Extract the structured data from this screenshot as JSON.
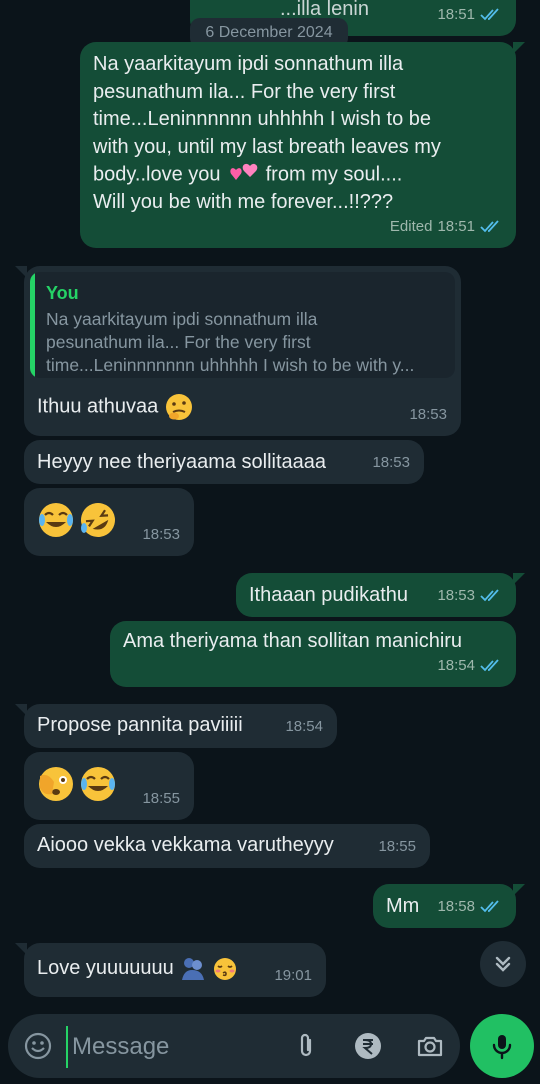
{
  "date_separator": "6 December 2024",
  "messages": [
    {
      "text": "...illa lenin",
      "time": "18:51"
    },
    {
      "text": "Na yaarkitayum ipdi sonnathum illa\npesunathum ila... For the very first\ntime...Leninnnnnn uhhhhh I wish to be\nwith you, until my last breath leaves my\nbody..love you",
      "text_after": "from my soul....\nWill you be with me forever...!!???",
      "edited_label": "Edited",
      "time": "18:51"
    },
    {
      "quote_author": "You",
      "quote_text": "Na yaarkitayum ipdi sonnathum illa\npesunathum ila... For the very first\ntime...Leninnnnnnn uhhhhh I wish to be with y...",
      "text": "Ithuu athuvaa",
      "time": "18:53"
    },
    {
      "text": "Heyyy nee theriyaama sollitaaaa",
      "time": "18:53"
    },
    {
      "text": "",
      "time": "18:53"
    },
    {
      "text": "Ithaaan pudikathu",
      "time": "18:53"
    },
    {
      "text": "Ama theriyama than sollitan manichiru",
      "time": "18:54"
    },
    {
      "text": "Propose pannita paviiiii",
      "time": "18:54"
    },
    {
      "text": "",
      "time": "18:55"
    },
    {
      "text": "Aiooo vekka vekkama varutheyyy",
      "time": "18:55"
    },
    {
      "text": "Mm",
      "time": "18:58"
    },
    {
      "text": "Love yuuuuuuu",
      "time": "19:01"
    }
  ],
  "composer": {
    "placeholder": "Message"
  },
  "icons": {
    "emoji": "smiley-icon",
    "attach": "paperclip-icon",
    "payment": "rupee-icon",
    "camera": "camera-icon",
    "mic": "mic-icon",
    "scroll": "double-chevron-down-icon",
    "read": "double-check-icon"
  },
  "colors": {
    "outgoing": "#144d37",
    "incoming": "#1f2c34",
    "read_ticks": "#53bdeb",
    "accent": "#25d366"
  }
}
